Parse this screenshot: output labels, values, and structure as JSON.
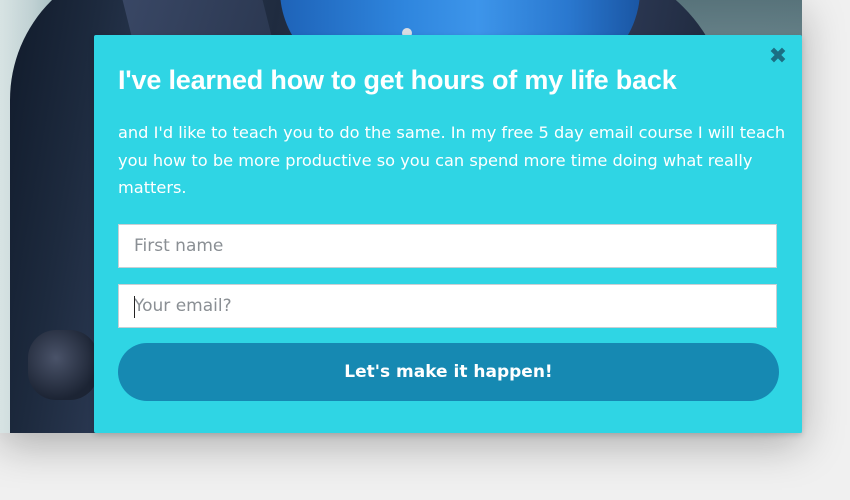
{
  "modal": {
    "close_icon": "close-icon",
    "close_glyph": "✖",
    "headline": "I've learned how to get hours of my life back",
    "body": "and I'd like to teach you to do the same. In my free 5 day email course I will teach you how to be more productive so you can spend more time doing what really matters.",
    "first_name": {
      "placeholder": "First name",
      "value": ""
    },
    "email": {
      "placeholder": "Your email?",
      "value": ""
    },
    "submit_label": "Let's make it happen!"
  },
  "colors": {
    "modal_background": "#2fd5e4",
    "button_background": "#1689b2",
    "close_icon": "#1b6f84",
    "text": "#ffffff"
  }
}
